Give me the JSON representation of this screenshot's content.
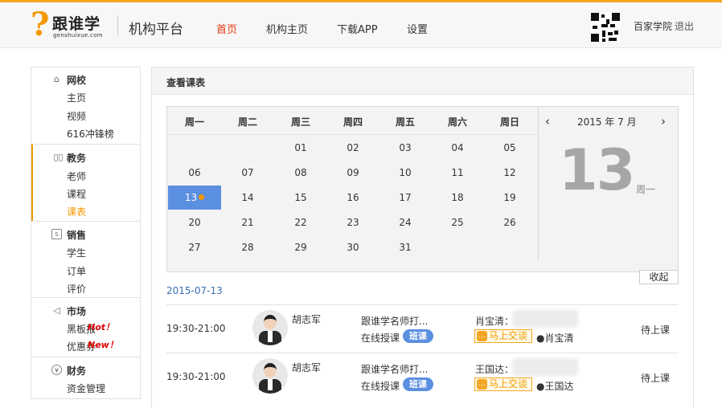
{
  "header": {
    "logo_mark": "?",
    "logo_cn": "跟谁学",
    "logo_en": "genshuixue.com",
    "site_title": "机构平台",
    "nav": [
      "首页",
      "机构主页",
      "下载APP",
      "设置"
    ],
    "active_nav": 0,
    "school": "百家学院",
    "logout": "退出",
    "accent_color": "#f39800",
    "nav_active_color": "#e8380d"
  },
  "sidebar": {
    "groups": [
      {
        "title": "网校",
        "icon": "home-icon",
        "items": [
          "主页",
          "视频",
          "616冲锋榜"
        ]
      },
      {
        "title": "教务",
        "icon": "book-icon",
        "items": [
          "老师",
          "课程",
          "课表"
        ]
      },
      {
        "title": "销售",
        "icon": "sale-icon",
        "items": [
          "学生",
          "订单",
          "评价"
        ]
      },
      {
        "title": "市场",
        "icon": "megaphone-icon",
        "items": [
          "黑板报",
          "优惠券"
        ]
      },
      {
        "title": "财务",
        "icon": "yen-icon",
        "items": [
          "资金管理"
        ]
      }
    ],
    "current_item": "课表",
    "hot_tag": "Hot！",
    "new_tag": "New！"
  },
  "panel": {
    "title": "查看课表"
  },
  "calendar": {
    "weekdays": [
      "周一",
      "周二",
      "周三",
      "周四",
      "周五",
      "周六",
      "周日"
    ],
    "weeks": [
      [
        "",
        "",
        "01",
        "02",
        "03",
        "04",
        "05"
      ],
      [
        "06",
        "07",
        "08",
        "09",
        "10",
        "11",
        "12"
      ],
      [
        "13",
        "14",
        "15",
        "16",
        "17",
        "18",
        "19"
      ],
      [
        "20",
        "21",
        "22",
        "23",
        "24",
        "25",
        "26"
      ],
      [
        "27",
        "28",
        "29",
        "30",
        "31",
        "",
        ""
      ]
    ],
    "selected": "13",
    "month_label": "2015 年 7 月",
    "prev": "‹",
    "next": "›",
    "big_day": "13",
    "big_weekday": "周一",
    "collapse": "收起",
    "selected_color": "#5b8fe0"
  },
  "schedule": {
    "date": "2015-07-13",
    "rows": [
      {
        "time": "19:30-21:00",
        "teacher": "胡志军",
        "course": "跟谁学名师打...",
        "mode": "在线授课",
        "badge": "班课",
        "student": "肖宝清：",
        "chat": "马上交谈",
        "user": "肖宝清",
        "status": "待上课"
      },
      {
        "time": "19:30-21:00",
        "teacher": "胡志军",
        "course": "跟谁学名师打...",
        "mode": "在线授课",
        "badge": "班课",
        "student": "王国达：",
        "chat": "马上交谈",
        "user": "王国达",
        "status": "待上课"
      }
    ]
  }
}
